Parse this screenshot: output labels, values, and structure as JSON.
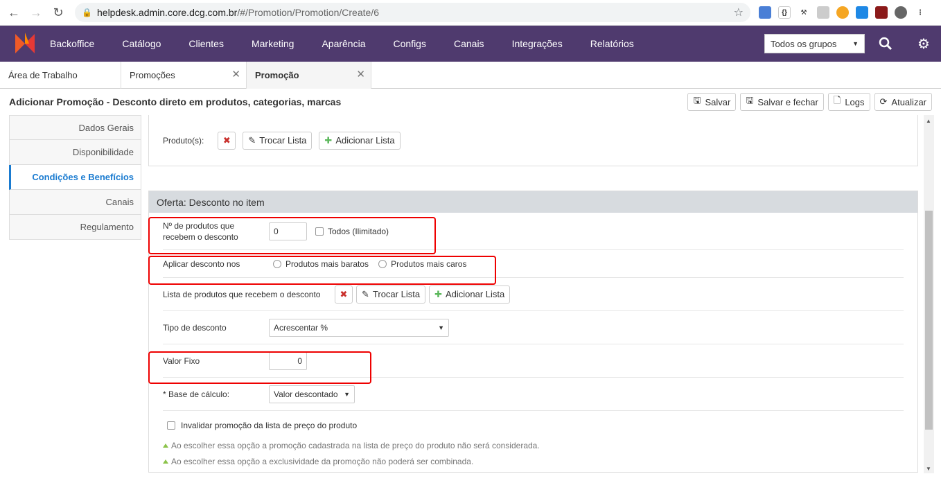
{
  "browser": {
    "url_host": "helpdesk.admin.core.dcg.com.br",
    "url_path": "/#/Promotion/Promotion/Create/6"
  },
  "topbar": {
    "menu": [
      "Backoffice",
      "Catálogo",
      "Clientes",
      "Marketing",
      "Aparência",
      "Configs",
      "Canais",
      "Integrações",
      "Relatórios"
    ],
    "group_select": "Todos os grupos"
  },
  "tabs": [
    {
      "label": "Área de Trabalho"
    },
    {
      "label": "Promoções"
    },
    {
      "label": "Promoção"
    }
  ],
  "page": {
    "title": "Adicionar Promoção - Desconto direto em produtos, categorias, marcas",
    "actions": {
      "save": "Salvar",
      "save_close": "Salvar e fechar",
      "logs": "Logs",
      "refresh": "Atualizar"
    }
  },
  "sidebar": [
    "Dados Gerais",
    "Disponibilidade",
    "Condições e Benefícios",
    "Canais",
    "Regulamento"
  ],
  "products": {
    "label": "Produto(s):",
    "swap": "Trocar Lista",
    "add": "Adicionar Lista"
  },
  "offer": {
    "header": "Oferta: Desconto no item",
    "qty_label": "Nº de produtos que recebem o desconto",
    "qty_value": "0",
    "unlimited": "Todos (Ilimitado)",
    "apply_label": "Aplicar desconto nos",
    "cheapest": "Produtos mais baratos",
    "priciest": "Produtos mais caros",
    "list_label": "Lista de produtos que recebem o desconto",
    "list_swap": "Trocar Lista",
    "list_add": "Adicionar Lista",
    "type_label": "Tipo de desconto",
    "type_value": "Acrescentar %",
    "fixed_label": "Valor Fixo",
    "fixed_value": "0",
    "base_label": "* Base de cálculo:",
    "base_value": "Valor descontado",
    "invalidate": "Invalidar promoção da lista de preço do produto",
    "note1": "Ao escolher essa opção a promoção cadastrada na lista de preço do produto não será considerada.",
    "note2": "Ao escolher essa opção a exclusividade da promoção não poderá ser combinada."
  }
}
